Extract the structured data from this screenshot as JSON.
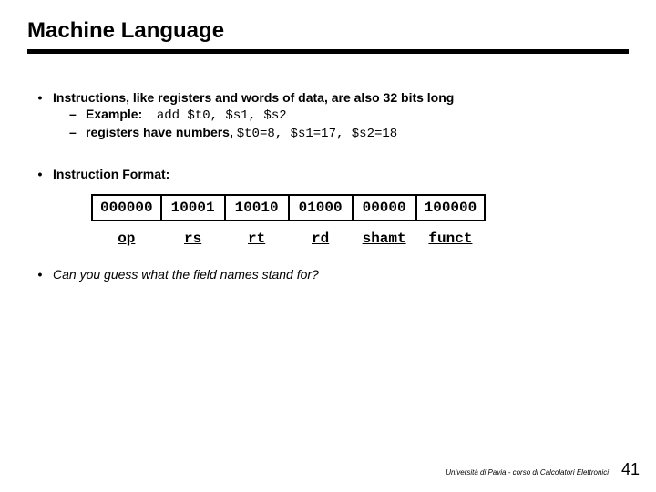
{
  "title": "Machine Language",
  "b1": {
    "line1": "Instructions, like registers and words of data, are also 32 bits long",
    "sub1_prefix": "Example:",
    "sub1_code": "add $t0, $s1, $s2",
    "sub2_prefix": "registers have numbers,",
    "sub2_code": "$t0=8, $s1=17, $s2=18"
  },
  "b2": {
    "line": "Instruction Format:"
  },
  "table": {
    "row": [
      "000000",
      "10001",
      "10010",
      "01000",
      "00000",
      "100000"
    ],
    "labels": [
      "op",
      "rs",
      "rt",
      "rd",
      "shamt",
      "funct"
    ]
  },
  "b3": {
    "line": "Can you guess what the field names stand for?"
  },
  "footer": {
    "credit": "Università di Pavia  - corso di Calcolatori Elettronici",
    "page": "41"
  }
}
